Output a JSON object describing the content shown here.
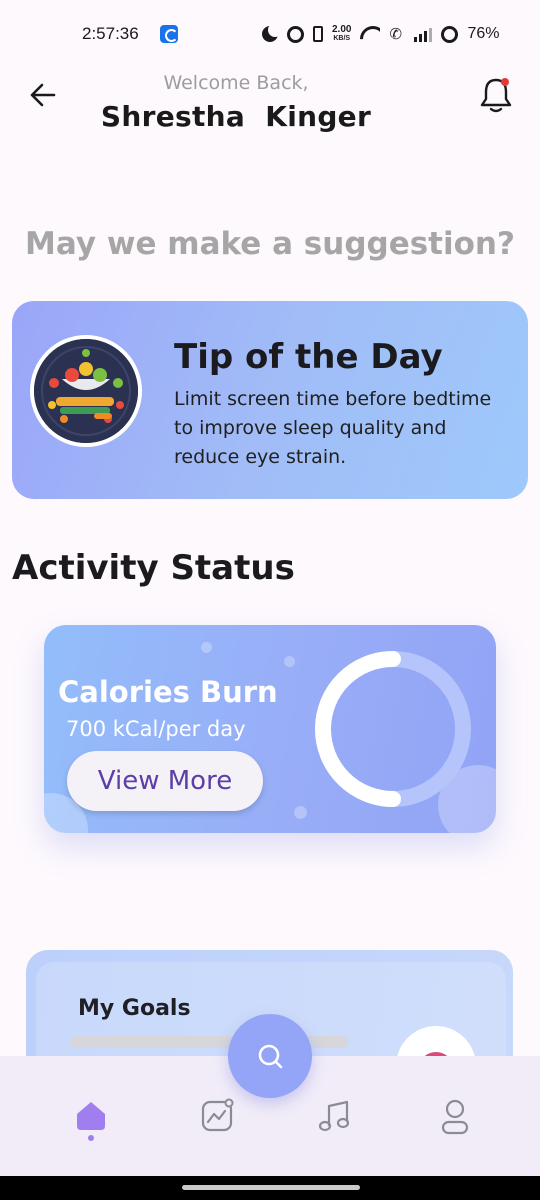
{
  "status_bar": {
    "time": "2:57:36",
    "net_speed": "2.00",
    "net_unit": "KB/S",
    "battery": "76%"
  },
  "header": {
    "welcome": "Welcome Back,",
    "user_name": "Shrestha  Kinger"
  },
  "suggestion_heading": "May we make a suggestion?",
  "tip": {
    "title": "Tip of the Day",
    "text": "Limit screen time before bedtime to improve sleep quality and reduce eye strain."
  },
  "activity": {
    "title": "Activity Status",
    "calories_title": "Calories Burn",
    "calories_value": "700 kCal/per day",
    "view_more": "View More",
    "progress": 0.5
  },
  "goals": {
    "title": "My Goals"
  },
  "nav": {
    "items": [
      "home",
      "activity",
      "music",
      "profile"
    ],
    "active": "home"
  },
  "colors": {
    "accent": "#94a4f6",
    "nav_active": "#a07ef0",
    "button_text": "#5b3ea6"
  }
}
